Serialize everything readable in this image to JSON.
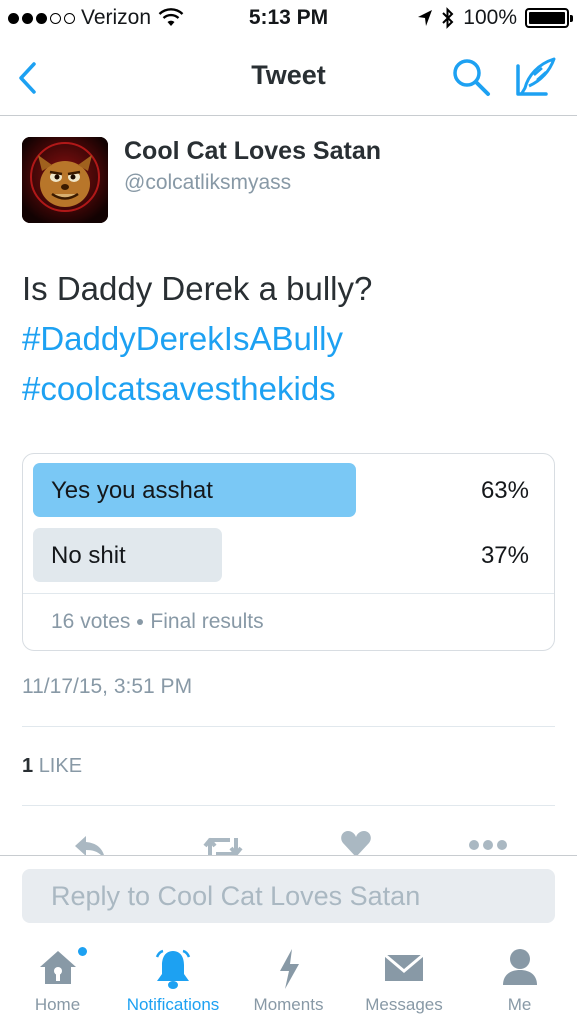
{
  "status_bar": {
    "carrier": "Verizon",
    "time": "5:13 PM",
    "battery": "100%",
    "signal_bars_filled": 3,
    "signal_bars_total": 5
  },
  "nav": {
    "title": "Tweet",
    "back_icon": "chevron-left-icon",
    "search_icon": "search-icon",
    "compose_icon": "compose-icon"
  },
  "tweet": {
    "display_name": "Cool Cat Loves Satan",
    "handle": "@colcatliksmyass",
    "text": "Is Daddy Derek a bully?",
    "hashtags": [
      "#DaddyDerekIsABully",
      "#coolcatsavesthekids"
    ],
    "timestamp": "11/17/15, 3:51 PM",
    "likes_count": "1",
    "likes_label": "LIKE"
  },
  "poll": {
    "options": [
      {
        "label": "Yes you asshat",
        "percent_text": "63%",
        "percent": 63,
        "winner": true
      },
      {
        "label": "No shit",
        "percent_text": "37%",
        "percent": 37,
        "winner": false
      }
    ],
    "votes": "16 votes",
    "status": "Final results"
  },
  "actions": [
    "reply-icon",
    "retweet-icon",
    "heart-icon",
    "more-icon"
  ],
  "reply": {
    "placeholder": "Reply to Cool Cat Loves Satan"
  },
  "tabs": [
    {
      "label": "Home",
      "icon": "home-icon",
      "active": false,
      "badge": true
    },
    {
      "label": "Notifications",
      "icon": "bell-icon",
      "active": true,
      "badge": false
    },
    {
      "label": "Moments",
      "icon": "lightning-icon",
      "active": false,
      "badge": false
    },
    {
      "label": "Messages",
      "icon": "envelope-icon",
      "active": false,
      "badge": false
    },
    {
      "label": "Me",
      "icon": "person-icon",
      "active": false,
      "badge": false
    }
  ],
  "colors": {
    "accent": "#1da1f2",
    "poll_winner": "#7ac8f5",
    "poll_other": "#e1e8ed",
    "gray_text": "#8899a6"
  }
}
